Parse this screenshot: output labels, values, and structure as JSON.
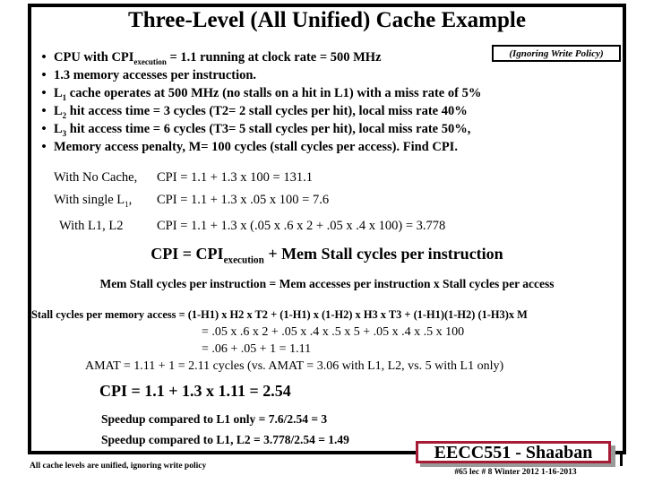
{
  "slide": {
    "title": "Three-Level (All Unified) Cache Example",
    "write_policy_note": "(Ignoring Write Policy)"
  },
  "bullets": [
    {
      "marker": "•",
      "text_html": "CPU with CPI<sub>execution</sub> = 1.1  running at clock rate = 500 MHz"
    },
    {
      "marker": "•",
      "text_html": "1.3 memory accesses per instruction."
    },
    {
      "marker": "•",
      "text_html": "L<sub>1</sub> cache operates at 500 MHz (no stalls on a hit in L1) with a miss rate of 5%"
    },
    {
      "marker": "•",
      "text_html": "L<sub>2</sub> hit access time = 3 cycles (T2= 2 stall cycles per hit),  local miss rate  40%"
    },
    {
      "marker": "•",
      "text_html": "L<sub>3</sub> hit access time = 6 cycles (T3= 5 stall cycles per hit), local miss rate 50%,"
    },
    {
      "marker": "•",
      "text_html": "Memory access penalty, M= 100 cycles  (stall cycles per access).   Find CPI."
    }
  ],
  "calculations": {
    "no_cache_label": "With No Cache,",
    "no_cache_value": "CPI  =  1.1 +  1.3 x 100  =  131.1",
    "single_l1_label_html": "With single L<sub>1</sub>,",
    "single_l1_value": "CPI  =  1.1 +  1.3 x .05 x 100 =  7.6",
    "l1_l2_label": "With L1,  L2",
    "l1_l2_value": "CPI  =  1.1 +  1.3 x  (.05 x .6  x 2  +  .05 x .4  x  100)  = 3.778"
  },
  "formulas": {
    "cpi_formula_html": "CPI =    CPI<sub>execution</sub>  +    Mem Stall  cycles per instruction",
    "mem_stall_formula": "Mem Stall cycles per instruction =  Mem accesses per instruction  x  Stall cycles per access",
    "stall_line_1": "Stall cycles per memory access   =   (1-H1) x H2 x T2  +  (1-H1) x (1-H2) x H3 x T3   + (1-H1)(1-H2) (1-H3)x M",
    "stall_line_2": "=  .05 x  .6  x  2   +  .05 x  .4  x  .5 x  5  +  .05  x  .4  x  .5  x  100",
    "stall_line_3": "=  .06 +     .05  +   1   =    1.11",
    "amat_line": "AMAT = 1.11 + 1 = 2.11 cycles  (vs.  AMAT = 3.06 with L1, L2,  vs.  5  with L1 only)"
  },
  "results": {
    "final_cpi": "CPI = 1.1 +  1.3 x 1.11   =   2.54",
    "speedup_l1_only": "Speedup compared to L1 only =  7.6/2.54  =  3",
    "speedup_l1_l2": "Speedup compared to L1, L2  =   3.778/2.54  =   1.49"
  },
  "footer": {
    "unified_note": "All cache levels are unified, ignoring write policy",
    "course_badge": "EECC551 - Shaaban",
    "badge_meta": "#65   lec # 8   Winter 2012  1-16-2013"
  },
  "colors": {
    "badge_border": "#a61c36",
    "badge_shadow": "#9a9a9a",
    "frame": "#000000",
    "text": "#000000",
    "background": "#ffffff"
  }
}
